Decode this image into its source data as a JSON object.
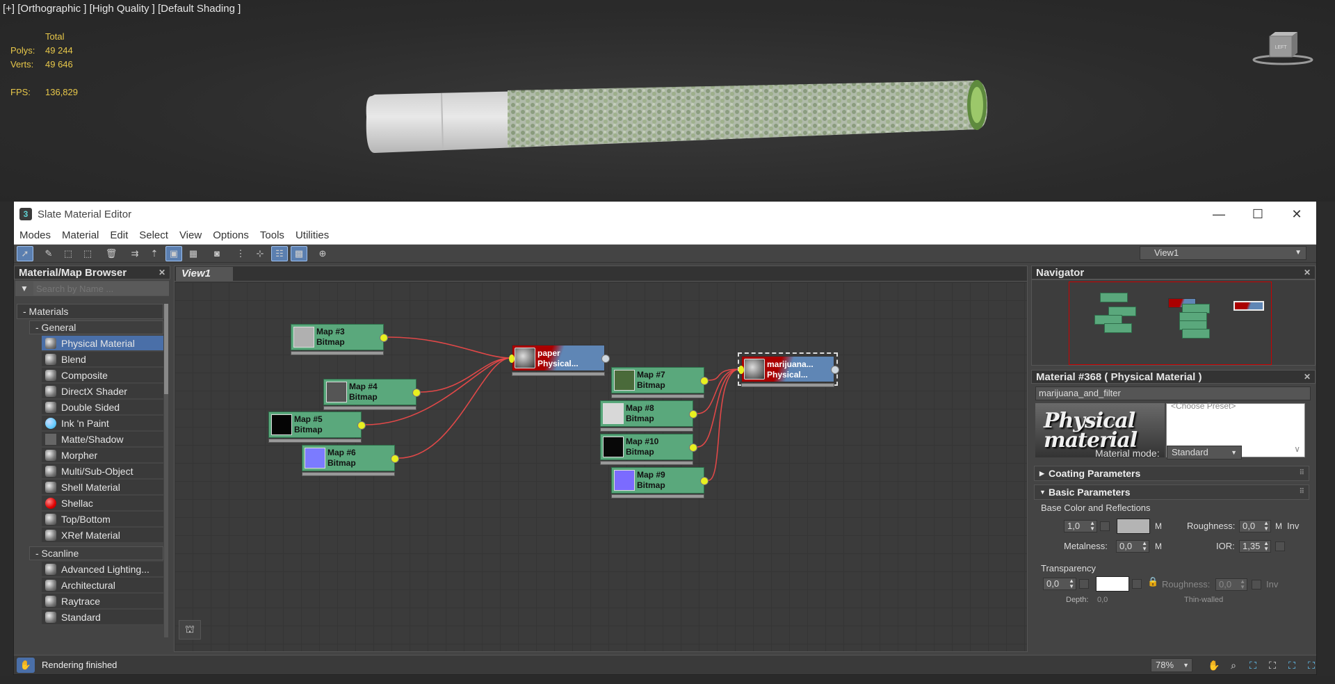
{
  "viewport": {
    "label": "[+] [Orthographic ] [High Quality ] [Default Shading ]",
    "stats": {
      "header": "Total",
      "polys_label": "Polys:",
      "polys_value": "49 244",
      "verts_label": "Verts:",
      "verts_value": "49 646",
      "fps_label": "FPS:",
      "fps_value": "136,829"
    },
    "viewcube_label": "LEFT"
  },
  "window": {
    "title": "Slate Material Editor",
    "app_icon": "3",
    "buttons": {
      "minimize": "—",
      "maximize": "☐",
      "close": "✕"
    }
  },
  "menu": [
    "Modes",
    "Material",
    "Edit",
    "Select",
    "View",
    "Options",
    "Tools",
    "Utilities"
  ],
  "toolbar": {
    "view_select": "View1",
    "icons": [
      "select-icon",
      "eyedropper-icon",
      "put-to-scene-icon",
      "assign-icon",
      "delete-icon",
      "move-children-icon",
      "hide-unused-icon",
      "show-map-icon",
      "show-background-icon",
      "show-end-result-icon",
      "layout-icon",
      "layout-children-icon",
      "material-id-icon",
      "select-by-material-icon",
      "pick-icon"
    ]
  },
  "browser": {
    "title": "Material/Map Browser",
    "search_placeholder": "Search by Name ...",
    "groups": [
      {
        "label": "- Materials"
      },
      {
        "label": "- General"
      }
    ],
    "general_items": [
      {
        "label": "Physical Material",
        "icon": "sphere",
        "selected": true
      },
      {
        "label": "Blend",
        "icon": "sphere"
      },
      {
        "label": "Composite",
        "icon": "sphere"
      },
      {
        "label": "DirectX Shader",
        "icon": "sphere"
      },
      {
        "label": "Double Sided",
        "icon": "sphere"
      },
      {
        "label": "Ink 'n Paint",
        "icon": "cyan"
      },
      {
        "label": "Matte/Shadow",
        "icon": "flat"
      },
      {
        "label": "Morpher",
        "icon": "sphere"
      },
      {
        "label": "Multi/Sub-Object",
        "icon": "sphere"
      },
      {
        "label": "Shell Material",
        "icon": "sphere"
      },
      {
        "label": "Shellac",
        "icon": "red"
      },
      {
        "label": "Top/Bottom",
        "icon": "sphere"
      },
      {
        "label": "XRef Material",
        "icon": "sphere"
      }
    ],
    "scanline_label": "- Scanline",
    "scanline_items": [
      {
        "label": "Advanced Lighting...",
        "icon": "sphere"
      },
      {
        "label": "Architectural",
        "icon": "sphere"
      },
      {
        "label": "Raytrace",
        "icon": "sphere"
      },
      {
        "label": "Standard",
        "icon": "sphere"
      }
    ]
  },
  "graph": {
    "tab": "View1",
    "nodes": [
      {
        "id": "map3",
        "name": "Map #3",
        "type": "Bitmap",
        "swatch": "#b0b0b0"
      },
      {
        "id": "map4",
        "name": "Map #4",
        "type": "Bitmap",
        "swatch": "#555555"
      },
      {
        "id": "map5",
        "name": "Map #5",
        "type": "Bitmap",
        "swatch": "#050505"
      },
      {
        "id": "map6",
        "name": "Map #6",
        "type": "Bitmap",
        "swatch": "#7b7bff"
      },
      {
        "id": "map7",
        "name": "Map #7",
        "type": "Bitmap",
        "swatch": "#4a6a3a"
      },
      {
        "id": "map8",
        "name": "Map #8",
        "type": "Bitmap",
        "swatch": "#d8d8d8"
      },
      {
        "id": "map10",
        "name": "Map #10",
        "type": "Bitmap",
        "swatch": "#080808"
      },
      {
        "id": "map9",
        "name": "Map #9",
        "type": "Bitmap",
        "swatch": "#7b6bff"
      }
    ],
    "materials": [
      {
        "id": "paper",
        "name": "paper",
        "type": "Physical..."
      },
      {
        "id": "marijuana",
        "name": "marijuana...",
        "type": "Physical..."
      }
    ]
  },
  "navigator": {
    "title": "Navigator"
  },
  "material_panel": {
    "title": "Material #368  ( Physical Material )",
    "name_value": "marijuana_and_filter",
    "preset_text": "<Choose Preset>",
    "preset_image_text": "Physical material",
    "mode_label": "Material mode:",
    "mode_value": "Standard",
    "rollouts": {
      "coating": "Coating Parameters",
      "basic": "Basic Parameters"
    },
    "base_section": "Base Color and Reflections",
    "base_weight": "1,0",
    "m_label": "M",
    "roughness_label": "Roughness:",
    "roughness_value": "0,0",
    "inv_label": "Inv",
    "metalness_label": "Metalness:",
    "metalness_value": "0,0",
    "ior_label": "IOR:",
    "ior_value": "1,35",
    "transparency_section": "Transparency",
    "transparency_weight": "0,0",
    "trans_roughness_label": "Roughness:",
    "trans_roughness_value": "0,0",
    "depth_label": "Depth:",
    "depth_value": "0,0",
    "thin_walled_label": "Thin-walled"
  },
  "status": {
    "text": "Rendering finished",
    "zoom": "78%"
  }
}
